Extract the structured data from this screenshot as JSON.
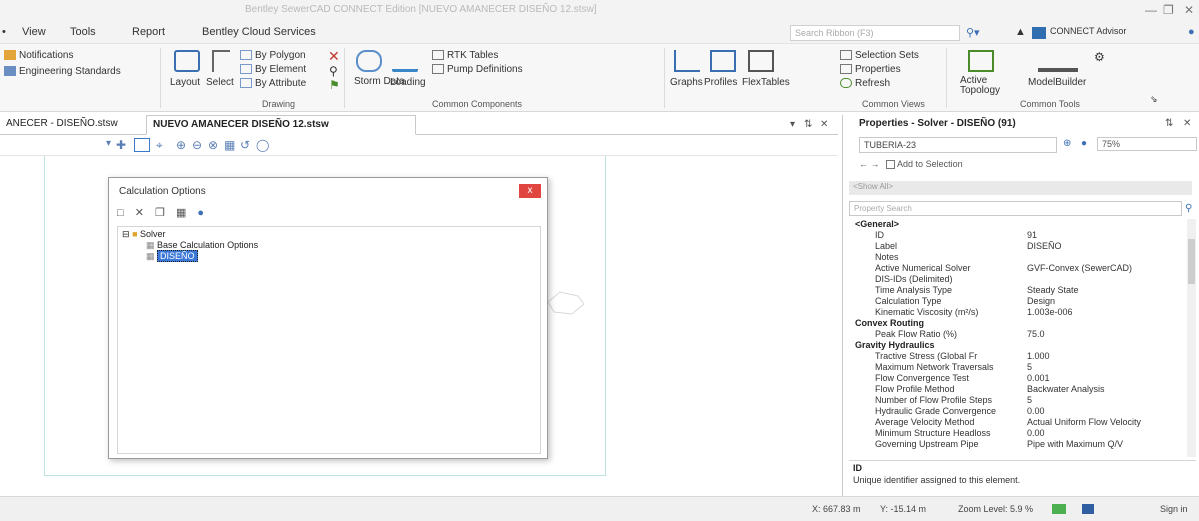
{
  "window": {
    "title": "Bentley SewerCAD CONNECT Edition [NUEVO AMANECER DISEÑO 12.stsw]",
    "search_placeholder": "Search Ribbon (F3)",
    "account": "CONNECT Advisor"
  },
  "menu": [
    "View",
    "Tools",
    "Report",
    "Bentley Cloud Services"
  ],
  "ribbon": {
    "left_items": [
      "Notifications",
      "Engineering Standards"
    ],
    "drawing": {
      "group": "Drawing",
      "layout": "Layout",
      "select": "Select",
      "by_polygon": "By Polygon",
      "by_element": "By Element",
      "by_attribute": "By Attribute"
    },
    "common_components": {
      "group": "Common Components",
      "storm_data": "Storm Data",
      "loading": "Loading",
      "rtk_tables": "RTK Tables",
      "pump_definitions": "Pump Definitions"
    },
    "common_views": {
      "group": "Common Views",
      "graphs": "Graphs",
      "profiles": "Profiles",
      "flextables": "FlexTables",
      "selection_sets": "Selection Sets",
      "properties": "Properties",
      "refresh": "Refresh"
    },
    "common_tools": {
      "group": "Common Tools",
      "active_topology": "Active Topology",
      "modelbuilder": "ModelBuilder"
    }
  },
  "doc_tabs": {
    "inactive": "ANECER - DISEÑO.stsw",
    "active": "NUEVO AMANECER DISEÑO 12.stsw"
  },
  "dialog": {
    "title": "Calculation Options",
    "close": "x",
    "tree": {
      "root": "Solver",
      "child1": "Base Calculation Options",
      "child2": "DISEÑO"
    }
  },
  "properties": {
    "title": "Properties - Solver - DISEÑO (91)",
    "element_combo": "TUBERIA-23",
    "zoom": "75%",
    "add_to_selection": "Add to Selection",
    "filter": "<Show All>",
    "search_placeholder": "Property Search",
    "rows": [
      {
        "type": "cat",
        "label": "<General>"
      },
      {
        "type": "row",
        "key": "ID",
        "value": "91"
      },
      {
        "type": "row",
        "key": "Label",
        "value": "DISEÑO"
      },
      {
        "type": "row",
        "key": "Notes",
        "value": ""
      },
      {
        "type": "row",
        "key": "Active Numerical Solver",
        "value": "GVF-Convex (SewerCAD)"
      },
      {
        "type": "row",
        "key": "DIS-IDs (Delimited)",
        "value": ""
      },
      {
        "type": "row",
        "key": "Time Analysis Type",
        "value": "Steady State"
      },
      {
        "type": "row",
        "key": "Calculation Type",
        "value": "Design"
      },
      {
        "type": "row",
        "key": "Kinematic Viscosity (m²/s)",
        "value": "1.003e-006"
      },
      {
        "type": "cat",
        "label": "Convex Routing"
      },
      {
        "type": "row",
        "key": "Peak Flow Ratio (%)",
        "value": "75.0"
      },
      {
        "type": "cat",
        "label": "Gravity Hydraulics"
      },
      {
        "type": "row",
        "key": "Tractive Stress (Global Fr",
        "value": "1.000"
      },
      {
        "type": "row",
        "key": "Maximum Network Traversals",
        "value": "5"
      },
      {
        "type": "row",
        "key": "Flow Convergence Test",
        "value": "0.001"
      },
      {
        "type": "row",
        "key": "Flow Profile Method",
        "value": "Backwater Analysis"
      },
      {
        "type": "row",
        "key": "Number of Flow Profile Steps",
        "value": "5"
      },
      {
        "type": "row",
        "key": "Hydraulic Grade Convergence",
        "value": "0.00"
      },
      {
        "type": "row",
        "key": "Average Velocity Method",
        "value": "Actual Uniform Flow Velocity"
      },
      {
        "type": "row",
        "key": "Minimum Structure Headloss",
        "value": "0.00"
      },
      {
        "type": "row",
        "key": "Governing Upstream Pipe",
        "value": "Pipe with Maximum Q/V"
      }
    ],
    "desc_title": "ID",
    "desc_text": "Unique identifier assigned to this element."
  },
  "status": {
    "x": "X: 667.83 m",
    "y": "Y: -15.14 m",
    "zoom": "Zoom Level: 5.9 %",
    "sign_in": "Sign in"
  }
}
